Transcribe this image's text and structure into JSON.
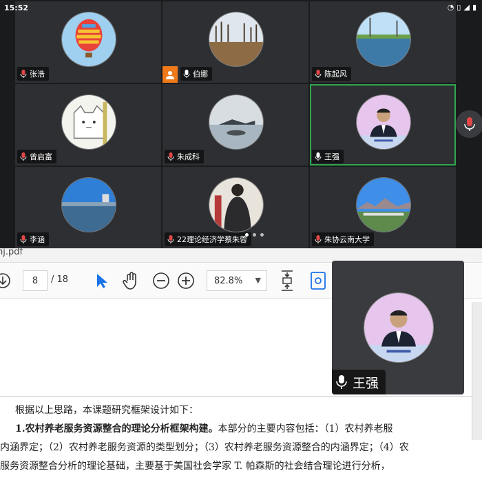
{
  "status_bar": {
    "time": "15:52",
    "icons": [
      "alarm-icon",
      "vibrate-icon",
      "signal-icon",
      "battery-icon"
    ]
  },
  "participants": [
    {
      "name": "张浩",
      "mic": "muted",
      "avatar": "hot-air-balloon"
    },
    {
      "name": "伯娜",
      "mic": "on",
      "avatar": "winter-field",
      "host": true
    },
    {
      "name": "陈起风",
      "mic": "muted",
      "avatar": "lake-reflection"
    },
    {
      "name": "曾启富",
      "mic": "muted",
      "avatar": "cat-drawing"
    },
    {
      "name": "朱成科",
      "mic": "muted",
      "avatar": "lake-island"
    },
    {
      "name": "王强",
      "mic": "on",
      "avatar": "speaker-portrait",
      "active": true
    },
    {
      "name": "李涵",
      "mic": "muted",
      "avatar": "waterfront"
    },
    {
      "name": "22理论经济学蔡朱蓉",
      "mic": "muted",
      "avatar": "person-back"
    },
    {
      "name": "朱协云南大学",
      "mic": "muted",
      "avatar": "mountain-landscape"
    }
  ],
  "floating_video": {
    "name": "王强"
  },
  "doc_viewer": {
    "title_fragment": "hj.pdf",
    "page_current": "8",
    "page_total": "/ 18",
    "zoom": "82.8%"
  },
  "doc_text": {
    "line1": "根据以上思路，本课题研究框架设计如下：",
    "line2_bold": "1.农村养老服务资源整合的理论分析框架构建。",
    "line2_rest": "本部分的主要内容包括：（1）农村养老服",
    "line3": "内涵界定；（2）农村养老服务资源的类型划分；（3）农村养老服务资源整合的内涵界定；（4）农",
    "line4": "服务资源整合分析的理论基础，主要基于美国社会学家 T. 帕森斯的社会结合理论进行分析，"
  },
  "colors": {
    "active_border": "#2fa84f",
    "host_badge": "#f07a1a",
    "tile_bg": "#2d2f32",
    "muted_mic": "#e04848",
    "accent_blue": "#1a73e8"
  }
}
